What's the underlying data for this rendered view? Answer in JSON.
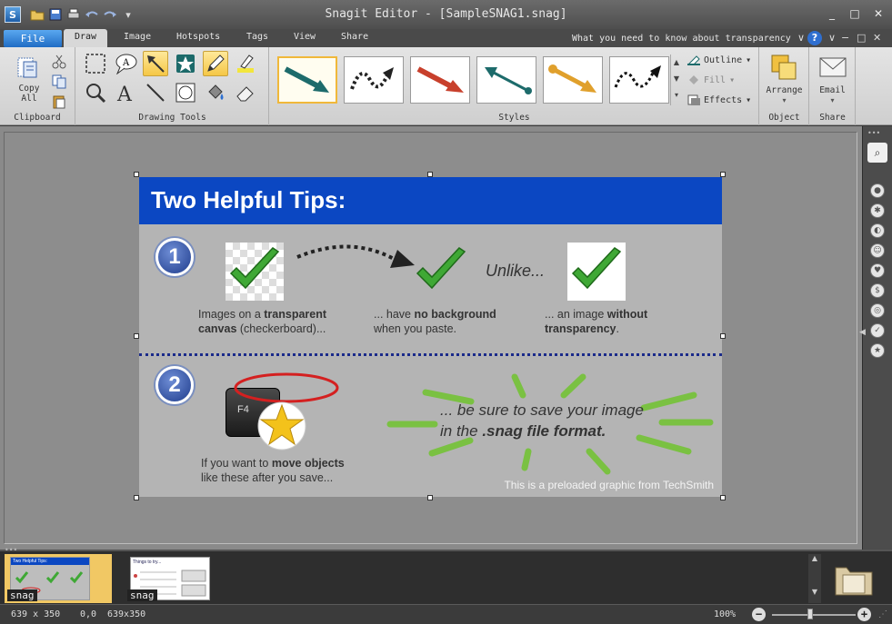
{
  "window": {
    "title": "Snagit Editor - [SampleSNAG1.snag]",
    "controls": [
      "_",
      "□",
      "✕"
    ]
  },
  "ribbon": {
    "file_label": "File",
    "tabs": [
      "Draw",
      "Image",
      "Hotspots",
      "Tags",
      "View",
      "Share"
    ],
    "active_tab": "Draw",
    "help_text": "What you need to know about transparency",
    "groups": {
      "clipboard": {
        "label": "Clipboard",
        "copy_all": "Copy All"
      },
      "drawing_tools": {
        "label": "Drawing Tools"
      },
      "styles": {
        "label": "Styles",
        "outline": "Outline",
        "fill": "Fill",
        "effects": "Effects"
      },
      "object": {
        "label": "Object",
        "arrange": "Arrange"
      },
      "share": {
        "label": "Share",
        "email": "Email"
      }
    },
    "colors": {
      "file_button": "#2f80d8",
      "selected_tool": "#f5c746"
    }
  },
  "graphic": {
    "title": "Two Helpful Tips:",
    "tip1_number": "1",
    "tip2_number": "2",
    "unlike": "Unlike...",
    "caption1_pre": "Images on a ",
    "caption1_bold": "transparent",
    "caption1_line2_bold": "canvas",
    "caption1_line2_rest": " (checkerboard)...",
    "caption2_pre": "... have ",
    "caption2_bold": "no background",
    "caption2_line2": "when you paste.",
    "caption3_pre": "... an image ",
    "caption3_bold": "without",
    "caption3_line2_bold": "transparency",
    "caption3_line2_rest": ".",
    "key_label": "F4",
    "caption4_pre": "If you want to ",
    "caption4_bold": "move objects",
    "caption4_line2": "like these after you save...",
    "note_line1": "... be sure to save your image",
    "note_line2_pre": "in the ",
    "note_line2_bold": ".snag file format.",
    "credit": "This is a preloaded graphic from TechSmith",
    "colors": {
      "header": "#0b47c2",
      "background": "#b4b4b4",
      "check": "#3fa835",
      "burst": "#7ac142",
      "circle": "#d42020"
    }
  },
  "tray": {
    "items": [
      {
        "label": "snag",
        "selected": true
      },
      {
        "label": "snag",
        "selected": false
      }
    ],
    "thumb1_title": "Two Helpful Tips:",
    "thumb2_title": "Things to try..."
  },
  "status": {
    "size": "639 x 350",
    "position": "0,0",
    "selection": "639x350",
    "zoom": "100%"
  }
}
